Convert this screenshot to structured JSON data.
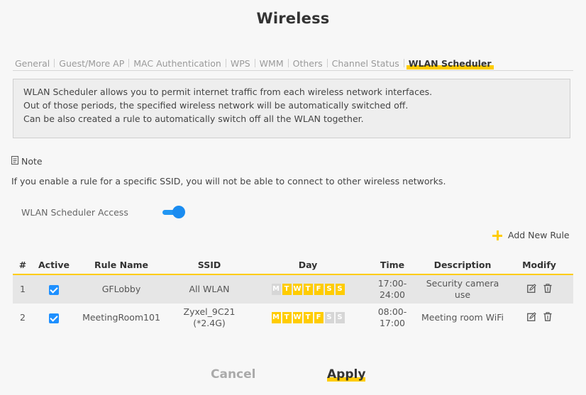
{
  "page": {
    "title": "Wireless"
  },
  "tabs": [
    {
      "label": "General",
      "active": false
    },
    {
      "label": "Guest/More AP",
      "active": false
    },
    {
      "label": "MAC Authentication",
      "active": false
    },
    {
      "label": "WPS",
      "active": false
    },
    {
      "label": "WMM",
      "active": false
    },
    {
      "label": "Others",
      "active": false
    },
    {
      "label": "Channel Status",
      "active": false
    },
    {
      "label": "WLAN Scheduler",
      "active": true
    }
  ],
  "info": {
    "lines": [
      "WLAN Scheduler allows you to permit internet traffic from each wireless network interfaces.",
      "Out of those periods, the specified wireless network will be automatically switched off.",
      "Can be also created a rule to automatically switch off all the WLAN together."
    ]
  },
  "note": {
    "icon": "note-icon",
    "header": "Note",
    "text": "If you enable a rule for a specific SSID, you will not be able to connect to other wireless networks."
  },
  "access": {
    "label": "WLAN Scheduler Access",
    "enabled": true
  },
  "add_rule": {
    "icon": "plus-icon",
    "label": "Add New Rule"
  },
  "table": {
    "headers": {
      "num": "#",
      "active": "Active",
      "rule_name": "Rule Name",
      "ssid": "SSID",
      "day": "Day",
      "time": "Time",
      "description": "Description",
      "modify": "Modify"
    },
    "day_letters": [
      "M",
      "T",
      "W",
      "T",
      "F",
      "S",
      "S"
    ],
    "rows": [
      {
        "num": "1",
        "active": true,
        "rule_name": "GFLobby",
        "ssid": "All WLAN",
        "ssid2": "",
        "days_on": [
          false,
          true,
          true,
          true,
          true,
          true,
          true
        ],
        "time_start": "17:00-",
        "time_end": "24:00",
        "desc1": "Security camera",
        "desc2": "use"
      },
      {
        "num": "2",
        "active": true,
        "rule_name": "MeetingRoom101",
        "ssid": "Zyxel_9C21",
        "ssid2": "(*2.4G)",
        "days_on": [
          true,
          true,
          true,
          true,
          true,
          false,
          false
        ],
        "time_start": "08:00-",
        "time_end": "17:00",
        "desc1": "Meeting room WiFi",
        "desc2": ""
      }
    ]
  },
  "buttons": {
    "cancel": "Cancel",
    "apply": "Apply"
  },
  "colors": {
    "accent": "#ffcc00",
    "toggle": "#2196f3",
    "checkbox": "#1e90ff"
  }
}
